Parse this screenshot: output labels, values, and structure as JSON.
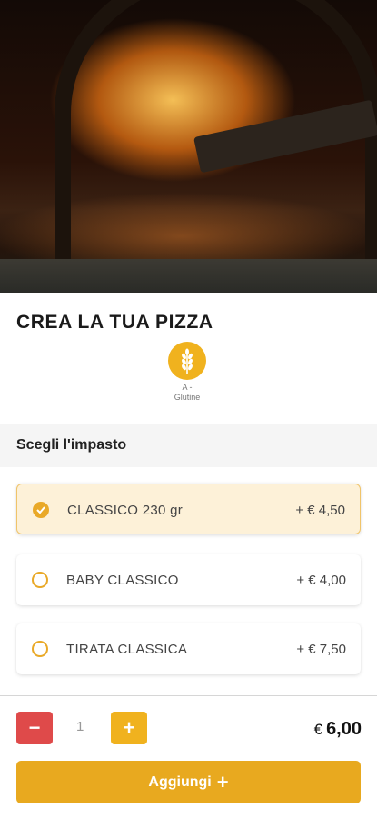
{
  "product": {
    "title": "CREA LA TUA PIZZA",
    "allergen": {
      "icon": "wheat-icon",
      "label_line1": "A -",
      "label_line2": "Glutine",
      "color": "#f0b21e"
    }
  },
  "section": {
    "title": "Scegli l'impasto"
  },
  "options": [
    {
      "name": "CLASSICO 230 gr",
      "price": "+ € 4,50",
      "selected": true
    },
    {
      "name": "BABY CLASSICO",
      "price": "+ € 4,00",
      "selected": false
    },
    {
      "name": "TIRATA CLASSICA",
      "price": "+ € 7,50",
      "selected": false
    }
  ],
  "cart": {
    "minus_label": "−",
    "quantity": "1",
    "plus_label": "+",
    "currency": "€",
    "total": "6,00",
    "add_label": "Aggiungi",
    "add_icon": "+"
  },
  "colors": {
    "accent": "#e8a91f",
    "minus": "#df4a4a",
    "selected_bg": "#fdf1d8"
  }
}
